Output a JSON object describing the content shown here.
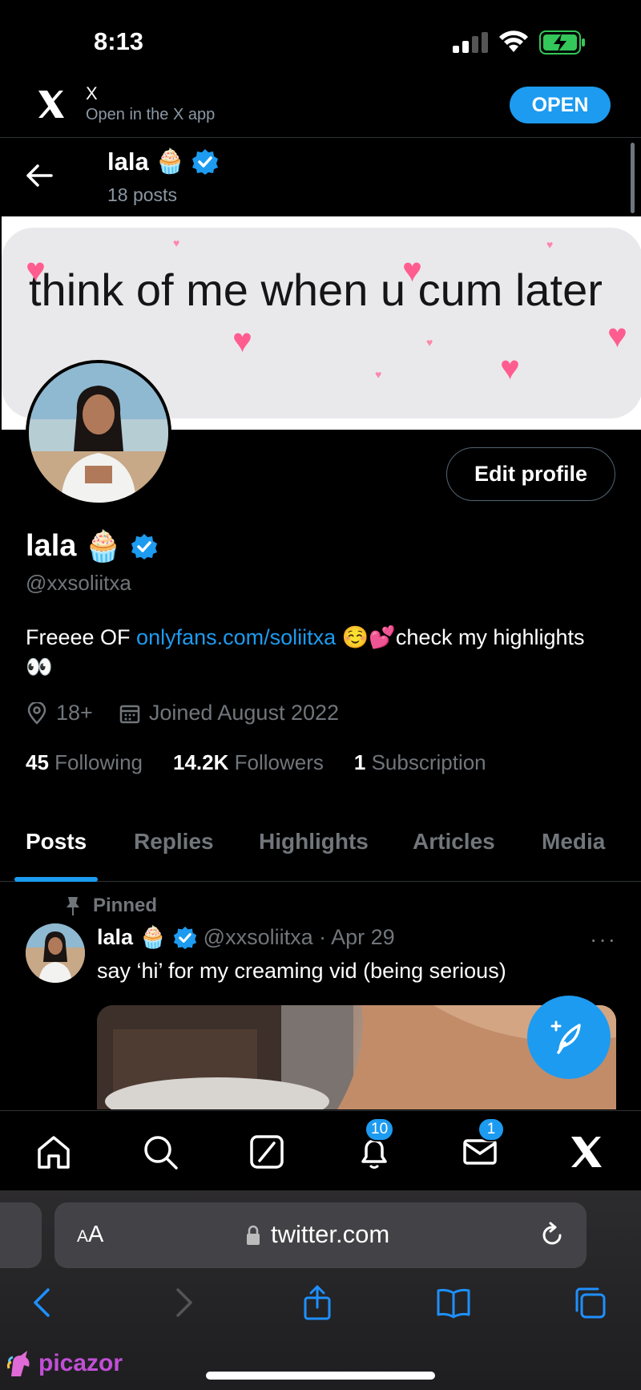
{
  "status": {
    "time": "8:13"
  },
  "app_banner": {
    "app_name": "X",
    "subtitle": "Open in the X app",
    "open_label": "OPEN"
  },
  "header": {
    "name": "lala",
    "name_emoji": "🧁",
    "posts": "18 posts"
  },
  "banner_image": {
    "text": "think of me when u cum later"
  },
  "profile": {
    "display_name": "lala",
    "name_emoji": "🧁",
    "handle": "@xxsoliitxa",
    "edit_label": "Edit profile",
    "bio_prefix": "Freeee OF ",
    "bio_link": "onlyfans.com/soliitxa",
    "bio_emoji": " ☺️💕",
    "bio_suffix": "check my highlights",
    "bio_end_emoji": " 👀",
    "location": "18+",
    "joined": "Joined August 2022",
    "following_count": "45",
    "following_label": "Following",
    "followers_count": "14.2K",
    "followers_label": "Followers",
    "subscription_count": "1",
    "subscription_label": "Subscription"
  },
  "tabs": [
    {
      "label": "Posts",
      "active": true
    },
    {
      "label": "Replies"
    },
    {
      "label": "Highlights"
    },
    {
      "label": "Articles"
    },
    {
      "label": "Media"
    }
  ],
  "pinned_post": {
    "pinned_label": "Pinned",
    "author": "lala",
    "emoji": "🧁",
    "handle_date": "@xxsoliitxa · Apr 29",
    "more": "···",
    "text": "say ‘hi’ for my creaming vid (being serious)"
  },
  "bottom_nav": {
    "notifications_badge": "10",
    "messages_badge": "1"
  },
  "safari": {
    "aa_big": "A",
    "aa_small": "A",
    "url": "twitter.com"
  },
  "watermark": "picazor",
  "colors": {
    "accent": "#1d9bf0",
    "background": "#000000",
    "secondary_text": "#71767b"
  }
}
